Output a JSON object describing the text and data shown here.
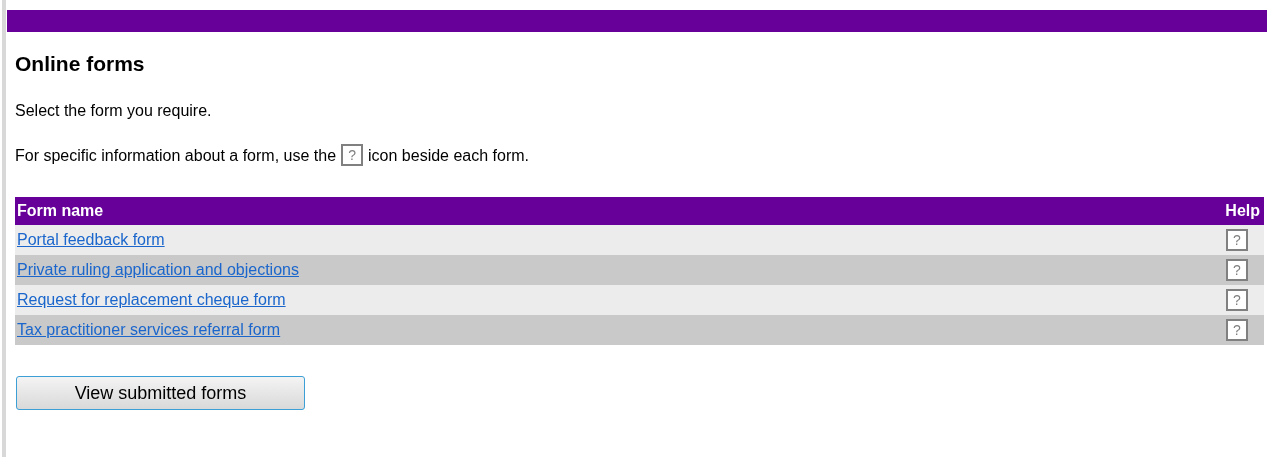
{
  "heading": "Online forms",
  "intro": "Select the form you require.",
  "help_note": {
    "before": "For specific information about a form, use the",
    "icon": "?",
    "after": "icon beside each form."
  },
  "table": {
    "columns": [
      "Form name",
      "Help"
    ],
    "rows": [
      {
        "name": "Portal feedback form",
        "help": "?"
      },
      {
        "name": "Private ruling application and objections",
        "help": "?"
      },
      {
        "name": "Request for replacement cheque form",
        "help": "?"
      },
      {
        "name": "Tax practitioner services referral form",
        "help": "?"
      }
    ]
  },
  "button": "View submitted forms"
}
